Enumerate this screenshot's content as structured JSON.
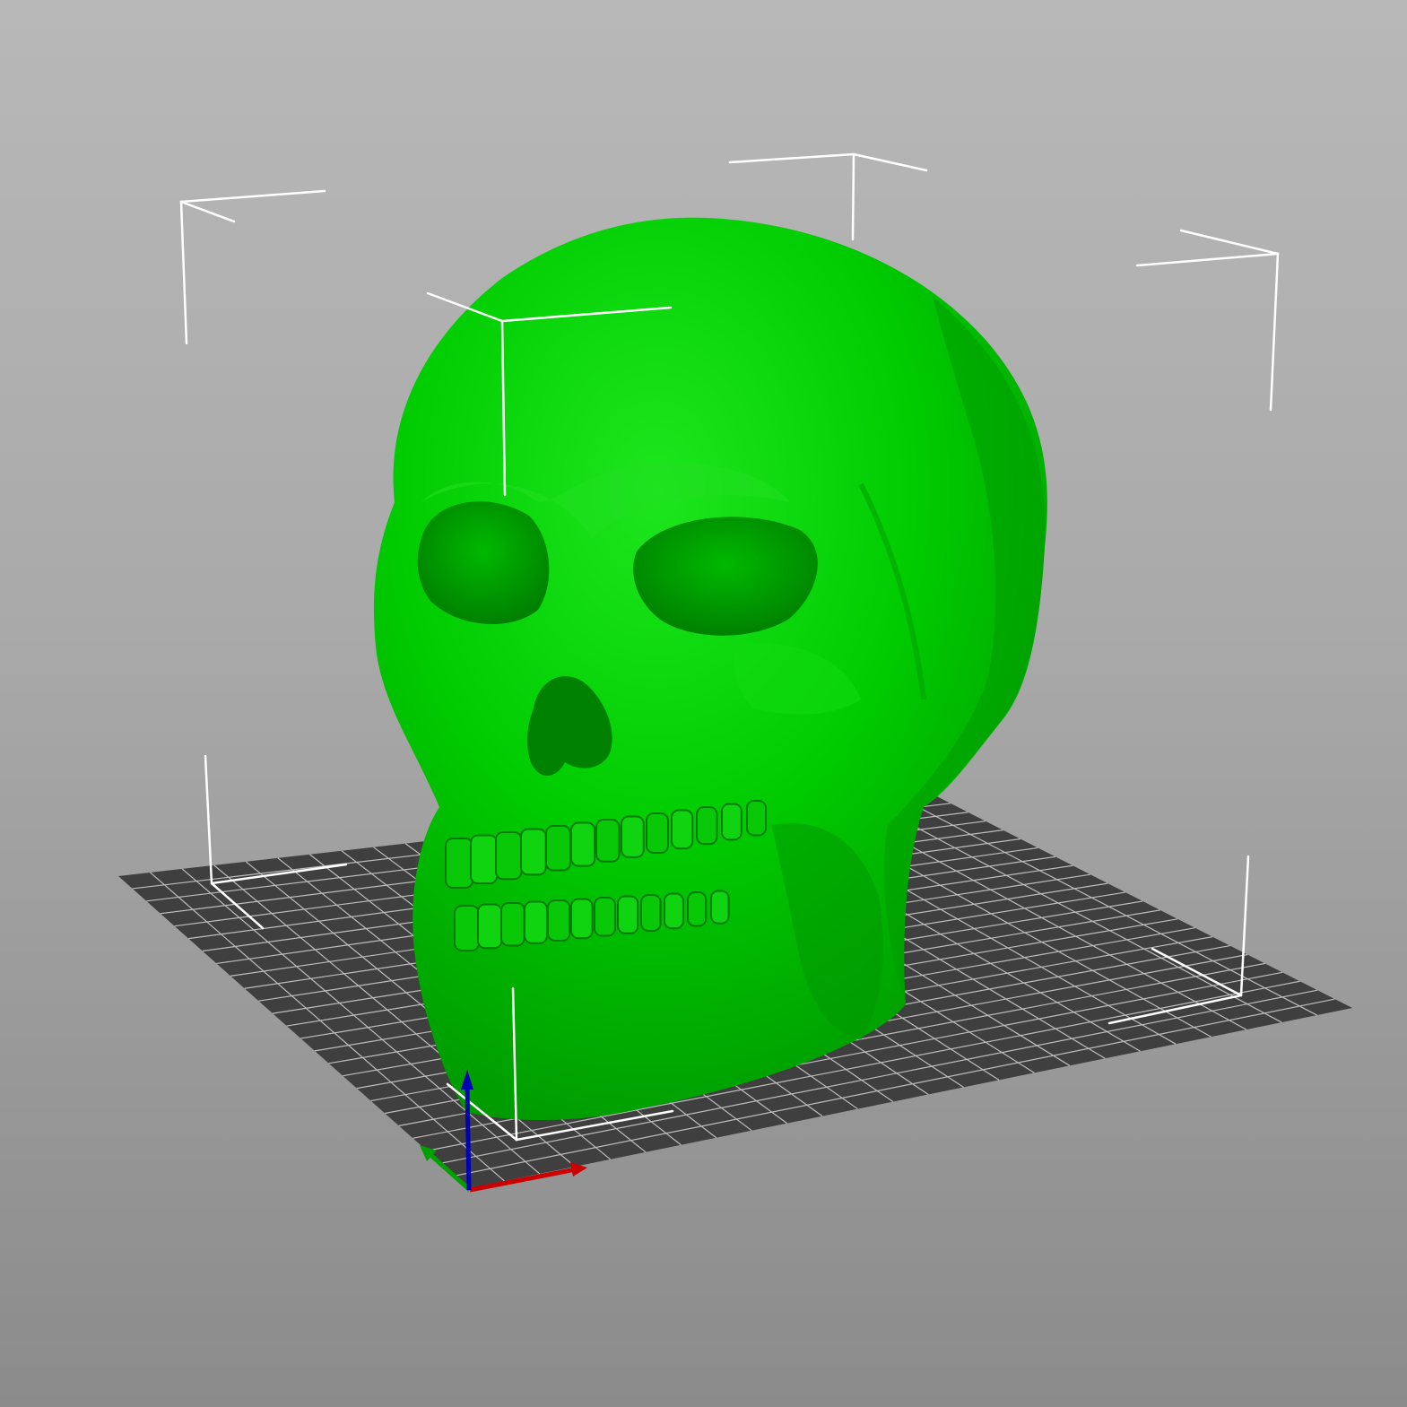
{
  "viewport": {
    "view": "3d-perspective",
    "background_top": "#b8b8b8",
    "background_bottom": "#8b8b8b"
  },
  "bed": {
    "surface_color": "#3f3f3f",
    "grid_color": "#bdbdbd"
  },
  "model": {
    "object": "skull",
    "selected": true,
    "color": "#00cc00",
    "selection_box_color": "#ffffff"
  },
  "axes": {
    "x_color": "#cc0000",
    "y_color": "#00a000",
    "z_color": "#0000b4"
  }
}
